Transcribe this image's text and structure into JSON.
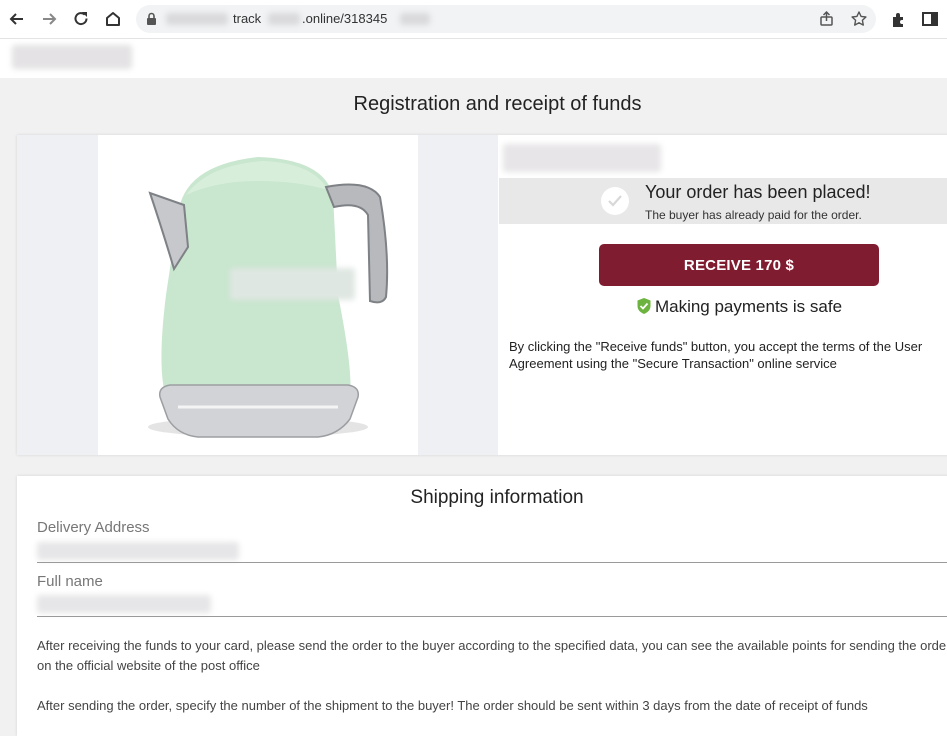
{
  "browser": {
    "url_prefix": "track",
    "url_suffix": ".online/318345",
    "icons": [
      "back-arrow-icon",
      "forward-arrow-icon",
      "reload-icon",
      "home-icon",
      "lock-icon",
      "share-icon",
      "star-icon",
      "extensions-icon",
      "side-panel-icon"
    ]
  },
  "page": {
    "title": "Registration and receipt of funds"
  },
  "order": {
    "status_title": "Your order has been placed!",
    "status_subtitle": "The buyer has already paid for the order.",
    "receive_button": "RECEIVE 170 $",
    "safe_text": "Making payments is safe",
    "terms_text": "By clicking the \"Receive funds\" button, you accept the terms of the User Agreement using the \"Secure Transaction\" online service"
  },
  "shipping": {
    "title": "Shipping information",
    "address_label": "Delivery Address",
    "name_label": "Full name",
    "note1": "After receiving the funds to your card, please send the order to the buyer according to the specified data, you can see the available points for sending the order on the official website of the post office",
    "note2": "After sending the order, specify the number of the shipment to the buyer! The order should be sent within 3 days from the date of receipt of funds"
  },
  "colors": {
    "button": "#7f1c2f",
    "safe_check": "#6db33f",
    "kettle": "#c9e6cf"
  }
}
